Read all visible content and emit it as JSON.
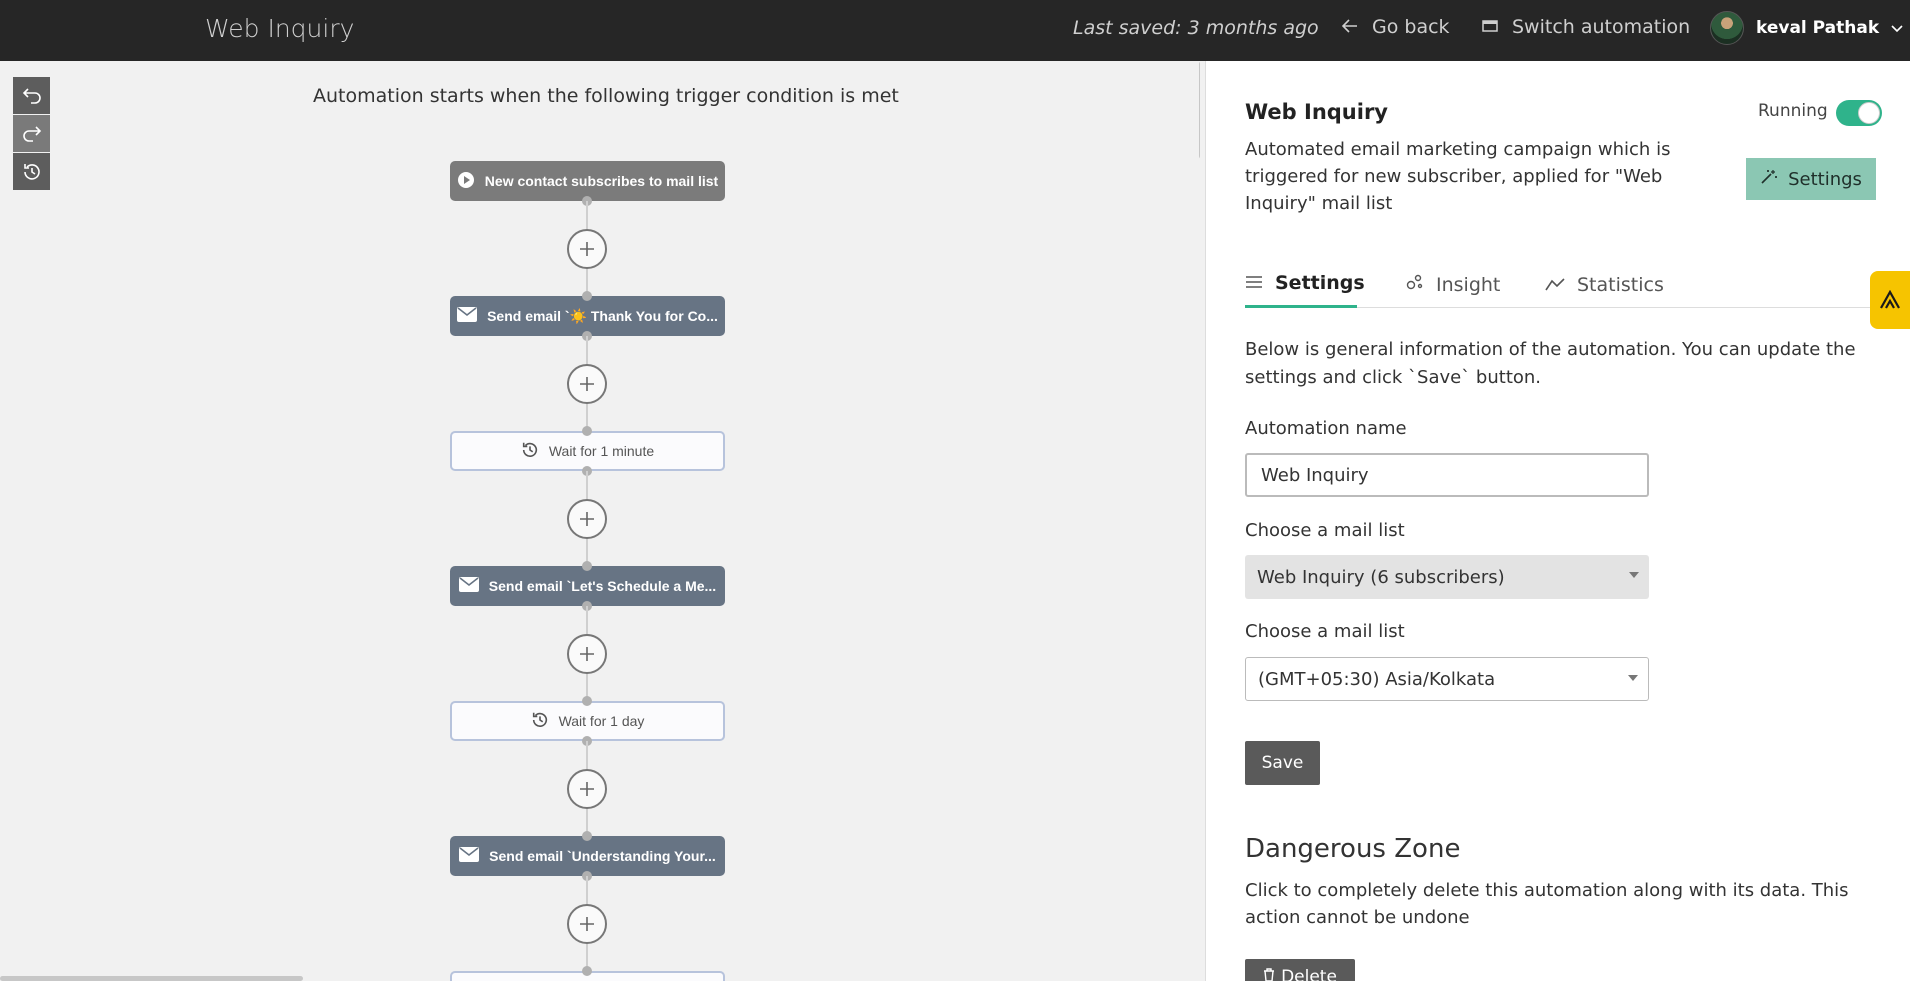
{
  "header": {
    "title": "Web Inquiry",
    "last_saved": "Last saved: 3 months ago",
    "go_back": "Go back",
    "switch_automation": "Switch automation",
    "user_name": "keval Pathak"
  },
  "canvas": {
    "trigger_text": "Automation starts when the following trigger condition is met",
    "nodes": [
      {
        "type": "trigger",
        "label": "New contact subscribes to mail list",
        "icon": "play-circle-icon"
      },
      {
        "type": "email",
        "label": "Send email `☀️ Thank You for Co...",
        "icon": "envelope-icon"
      },
      {
        "type": "wait",
        "label": "Wait for 1 minute",
        "icon": "history-icon"
      },
      {
        "type": "email",
        "label": "Send email `Let's Schedule a Me...",
        "icon": "envelope-icon"
      },
      {
        "type": "wait",
        "label": "Wait for 1 day",
        "icon": "history-icon"
      },
      {
        "type": "email",
        "label": "Send email `Understanding Your...",
        "icon": "envelope-icon"
      }
    ]
  },
  "panel": {
    "title": "Web Inquiry",
    "description": "Automated email marketing campaign which is triggered for new subscriber, applied for \"Web Inquiry\" mail list",
    "status_label": "Running",
    "status_on": true,
    "settings_button": "Settings",
    "tabs": [
      {
        "label": "Settings",
        "icon": "list-icon",
        "active": true
      },
      {
        "label": "Insight",
        "icon": "insight-icon",
        "active": false
      },
      {
        "label": "Statistics",
        "icon": "chart-line-icon",
        "active": false
      }
    ],
    "intro": "Below is general information of the automation. You can update the settings and click `Save` button.",
    "name_label": "Automation name",
    "name_value": "Web Inquiry",
    "mail_list_label": "Choose a mail list",
    "mail_list_value": "Web Inquiry (6 subscribers)",
    "timezone_label": "Choose a mail list",
    "timezone_value": "(GMT+05:30) Asia/Kolkata",
    "save_button": "Save",
    "danger_title": "Dangerous Zone",
    "danger_desc": "Click to completely delete this automation along with its data. This action cannot be undone",
    "delete_button": "Delete"
  },
  "colors": {
    "topbar": "#262626",
    "accent": "#2fb38b",
    "settings_button": "#8bc7b3",
    "email_node": "#677484",
    "trigger_node": "#7b7b7b",
    "wait_border": "#b7c3dc",
    "widget": "#f6c400"
  }
}
